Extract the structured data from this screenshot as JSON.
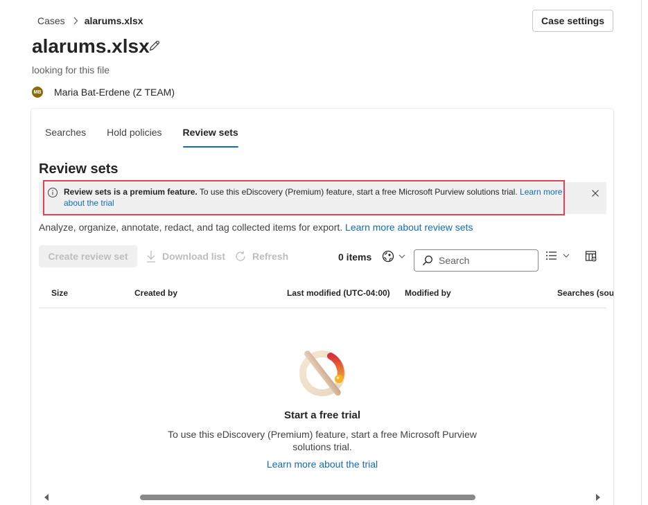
{
  "breadcrumb": {
    "parent": "Cases",
    "current": "alarums.xlsx"
  },
  "header": {
    "title": "alarums.xlsx",
    "description": "looking for this file",
    "owner_initials": "MB",
    "owner_name": "Maria Bat-Erdene (Z TEAM)",
    "case_settings_label": "Case settings"
  },
  "tabs": [
    {
      "label": "Searches",
      "active": false
    },
    {
      "label": "Hold policies",
      "active": false
    },
    {
      "label": "Review sets",
      "active": true
    }
  ],
  "section": {
    "title": "Review sets",
    "banner": {
      "bold": "Review sets is a premium feature.",
      "text": " To use this eDiscovery (Premium) feature, start a free Microsoft Purview solutions trial. ",
      "link": "Learn more about the trial",
      "close_icon": "dismiss-icon"
    },
    "description": "Analyze, organize, annotate, redact, and tag collected items for export.",
    "description_link": "Learn more about review sets"
  },
  "toolbar": {
    "create_label": "Create review set",
    "download_label": "Download list",
    "refresh_label": "Refresh",
    "items_count": "0 items",
    "search_placeholder": "Search",
    "icons": [
      "download-icon",
      "refresh-icon",
      "globe-icon",
      "search-icon",
      "list-view-icon",
      "column-options-icon"
    ]
  },
  "table": {
    "columns": [
      "Size",
      "Created by",
      "Last modified (UTC-04:00)",
      "Modified by",
      "Searches (sou"
    ]
  },
  "empty_state": {
    "title": "Start a free trial",
    "description": "To use this eDiscovery (Premium) feature, start a free Microsoft Purview solutions trial.",
    "link": "Learn more about the trial"
  },
  "colors": {
    "accent": "#0f6cbd",
    "highlight_border": "#e5404f",
    "banner_bg": "#f0f0f0",
    "avatar_bg": "#8a6d07"
  }
}
